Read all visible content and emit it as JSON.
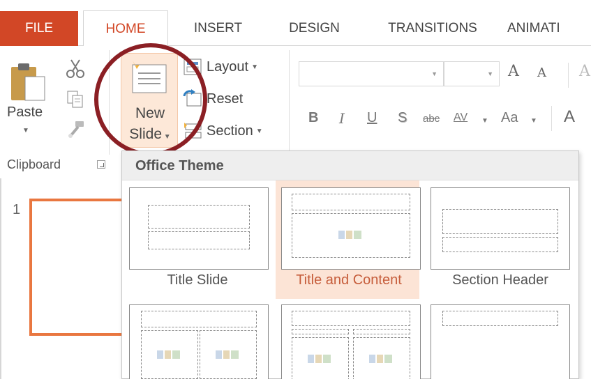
{
  "tabs": {
    "file": "FILE",
    "home": "HOME",
    "insert": "INSERT",
    "design": "DESIGN",
    "transitions": "TRANSITIONS",
    "animations": "ANIMATI"
  },
  "clipboard": {
    "paste_label": "Paste",
    "group_label": "Clipboard"
  },
  "slides_group": {
    "new_slide_line1": "New",
    "new_slide_line2": "Slide",
    "layout_label": "Layout",
    "reset_label": "Reset",
    "section_label": "Section"
  },
  "font_group": {
    "grow_font": "A",
    "shrink_font": "A",
    "bold": "B",
    "italic": "I",
    "underline": "U",
    "shadow": "S",
    "strikethrough": "abc",
    "spacing": "AV",
    "change_case": "Aa",
    "clear": "A"
  },
  "slide_pane": {
    "slide_number": "1"
  },
  "gallery": {
    "header": "Office Theme",
    "layouts": [
      {
        "label": "Title Slide"
      },
      {
        "label": "Title and Content"
      },
      {
        "label": "Section Header"
      }
    ]
  },
  "colors": {
    "accent": "#d24726",
    "selected_fill": "#fce4d6",
    "annotation_circle": "#8b1f24"
  }
}
